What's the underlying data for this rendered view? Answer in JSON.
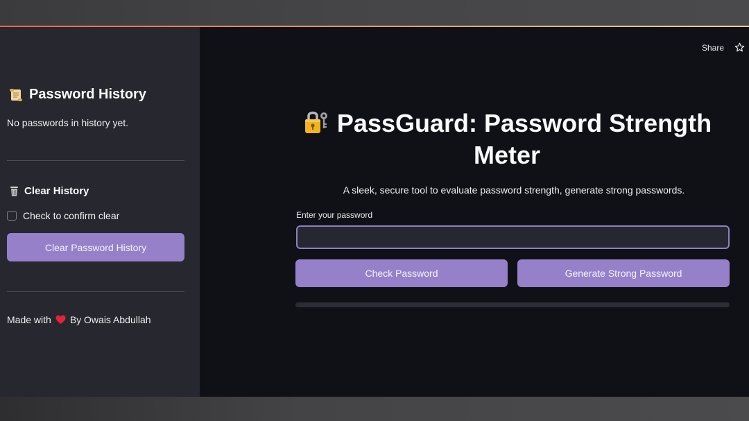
{
  "sidebar": {
    "history_heading": "Password History",
    "history_empty": "No passwords in history yet.",
    "clear_heading": "Clear History",
    "confirm_checkbox_label": "Check to confirm clear",
    "confirm_checked": false,
    "clear_button_label": "Clear Password History",
    "footer_prefix": "Made with",
    "footer_suffix": "By Owais Abdullah",
    "icons": [
      "scroll-icon",
      "trash-icon",
      "heart-icon"
    ]
  },
  "toolbar": {
    "share_label": "Share",
    "star_icon": "star-icon"
  },
  "main": {
    "title": "PassGuard: Password Strength Meter",
    "title_icon": "lock-with-key-icon",
    "subtitle": "A sleek, secure tool to evaluate password strength, generate strong passwords.",
    "input_label": "Enter your password",
    "input_value": "",
    "input_placeholder": "",
    "check_button_label": "Check Password",
    "generate_button_label": "Generate Strong Password",
    "strength_progress": 0
  },
  "colors": {
    "accent": "#9580c9",
    "sidebar_bg": "#26272f",
    "main_bg": "#0f1116",
    "input_border": "#8e80c4",
    "heart": "#e0243a"
  }
}
